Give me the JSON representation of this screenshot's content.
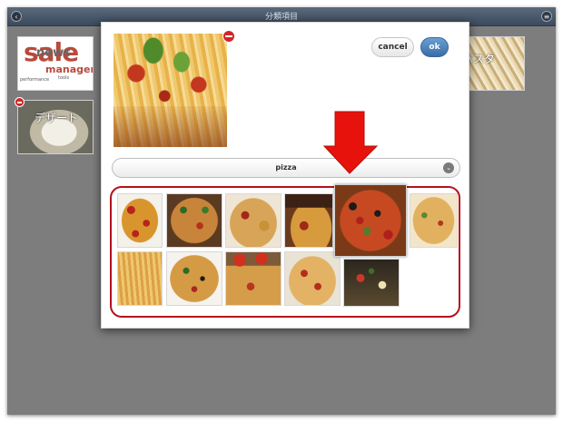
{
  "window": {
    "title": "分類項目",
    "back_icon": "chevron-left-icon",
    "menu_icon": "list-icon"
  },
  "background_tiles": [
    {
      "name": "sale",
      "words": [
        "sale",
        "news",
        "manageme",
        "performance",
        "tools"
      ]
    },
    {
      "name": "dessert",
      "label": "デザート"
    },
    {
      "name": "pasta",
      "label": "パスタ"
    }
  ],
  "dialog": {
    "cancel_label": "cancel",
    "ok_label": "ok",
    "category_value": "pizza",
    "category_icon": "chevron-down-icon",
    "selected_thumbnail_index": 4,
    "thumbnail_count": 11
  },
  "colors": {
    "ok_button": "#3a6da6",
    "highlight_frame": "#b5111b",
    "arrow": "#e8120c",
    "remove_badge": "#d1262a"
  }
}
